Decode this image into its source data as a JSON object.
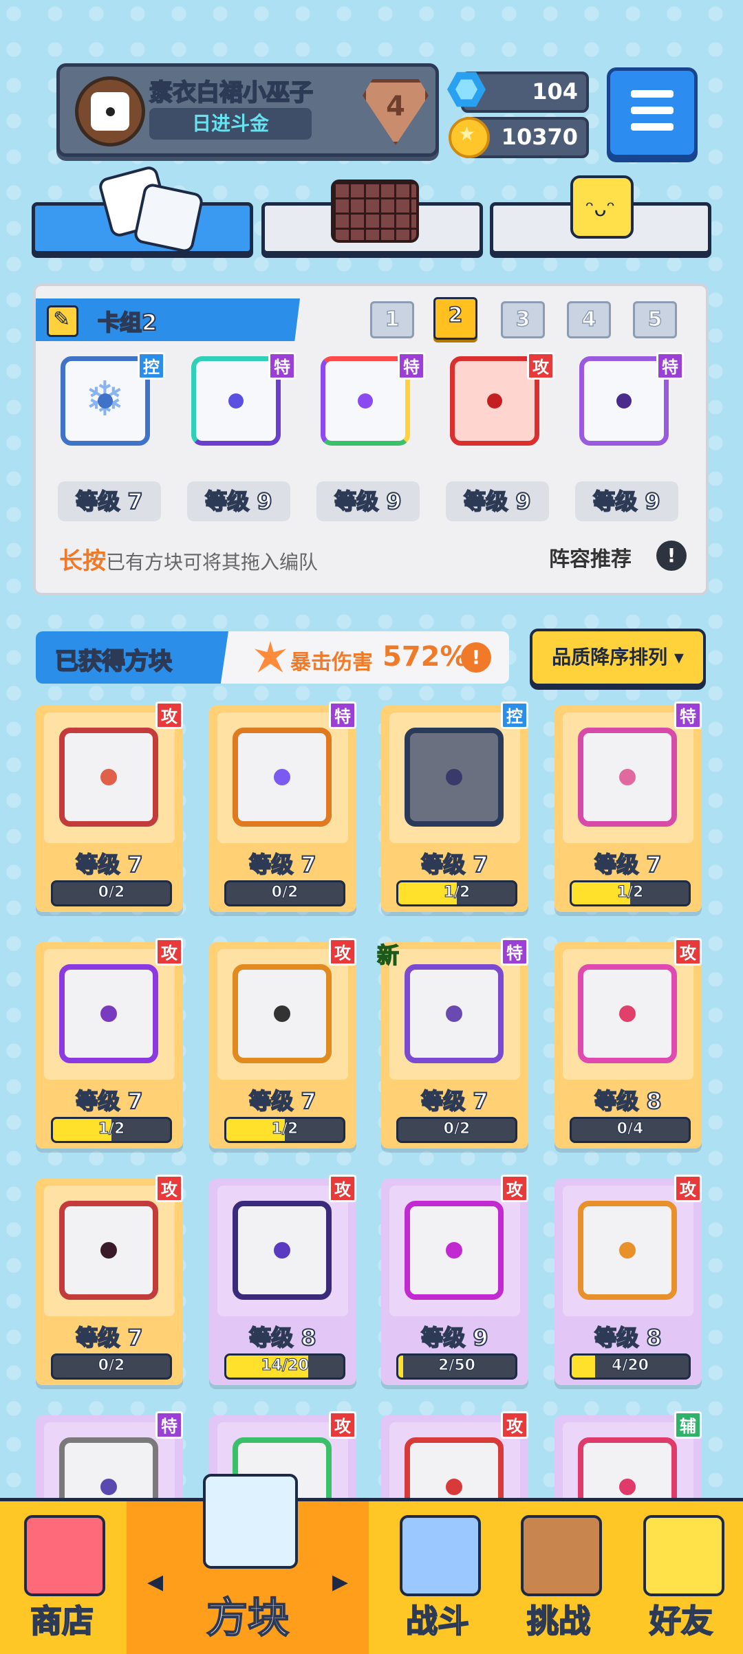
{
  "player": {
    "name": "素衣白裙小巫子",
    "title": "日进斗金",
    "rank": "4"
  },
  "currency": {
    "gems": "104",
    "coins": "10370"
  },
  "colors": {
    "accent_blue": "#2b8ee8",
    "gold": "#ffd074",
    "purple": "#e2c6f5",
    "attack": "#e83a3a",
    "special": "#9b3fd6",
    "control": "#2b8ee8",
    "support": "#2fb36a"
  },
  "deck": {
    "title": "卡组2",
    "tabs": [
      "1",
      "2",
      "3",
      "4",
      "5"
    ],
    "active_tab": "2",
    "cards": [
      {
        "badge": "控",
        "level": "等级 7"
      },
      {
        "badge": "特",
        "level": "等级 9"
      },
      {
        "badge": "特",
        "level": "等级 9"
      },
      {
        "badge": "攻",
        "level": "等级 9"
      },
      {
        "badge": "特",
        "level": "等级 9"
      }
    ],
    "tip_highlight": "长按",
    "tip_text": "已有方块可将其拖入编队",
    "recommend": "阵容推荐",
    "recommend_icon": "!"
  },
  "obtained": {
    "label": "已获得方块",
    "crit_label": "暴击伤害",
    "crit_value": "572%",
    "crit_icon": "!",
    "sort_label": "品质降序排列 ▾"
  },
  "grid": [
    {
      "badge": "攻",
      "level": "等级 7",
      "progress": "0/2",
      "fill": 0
    },
    {
      "badge": "特",
      "level": "等级 7",
      "progress": "0/2",
      "fill": 0
    },
    {
      "badge": "控",
      "level": "等级 7",
      "progress": "1/2",
      "fill": 0.5
    },
    {
      "badge": "特",
      "level": "等级 7",
      "progress": "1/2",
      "fill": 0.5
    },
    {
      "badge": "攻",
      "level": "等级 7",
      "progress": "1/2",
      "fill": 0.5
    },
    {
      "badge": "攻",
      "level": "等级 7",
      "progress": "1/2",
      "fill": 0.5
    },
    {
      "badge": "特",
      "level": "等级 7",
      "progress": "0/2",
      "fill": 0,
      "new": "新"
    },
    {
      "badge": "攻",
      "level": "等级 8",
      "progress": "0/4",
      "fill": 0
    },
    {
      "badge": "攻",
      "level": "等级 7",
      "progress": "0/2",
      "fill": 0
    },
    {
      "badge": "攻",
      "level": "等级 8",
      "progress": "14/20",
      "fill": 0.7
    },
    {
      "badge": "攻",
      "level": "等级 9",
      "progress": "2/50",
      "fill": 0.04
    },
    {
      "badge": "攻",
      "level": "等级 8",
      "progress": "4/20",
      "fill": 0.2
    },
    {
      "badge": "特"
    },
    {
      "badge": "攻"
    },
    {
      "badge": "攻"
    },
    {
      "badge": "辅"
    }
  ],
  "nav": {
    "shop": "商店",
    "blocks": "方块",
    "battle": "战斗",
    "challenge": "挑战",
    "friends": "好友",
    "prev": "◀",
    "next": "▶"
  }
}
